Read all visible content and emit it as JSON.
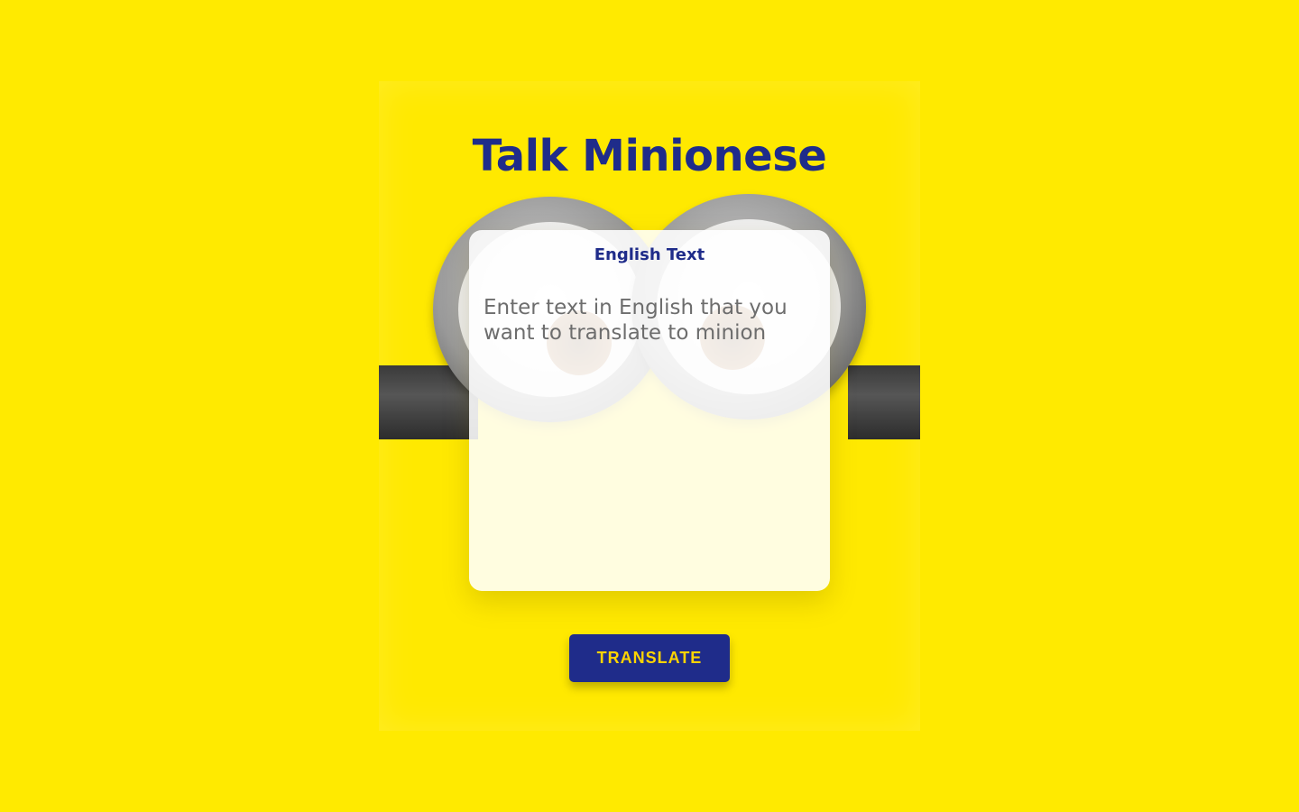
{
  "app": {
    "title": "Talk Minionese"
  },
  "input_card": {
    "label": "English Text",
    "value": "",
    "placeholder": "Enter text in English that you want to translate to minion"
  },
  "actions": {
    "translate_label": "TRANSLATE"
  },
  "colors": {
    "background": "#FFEA00",
    "primary": "#1F2C8A",
    "button_text": "#FFD400"
  }
}
